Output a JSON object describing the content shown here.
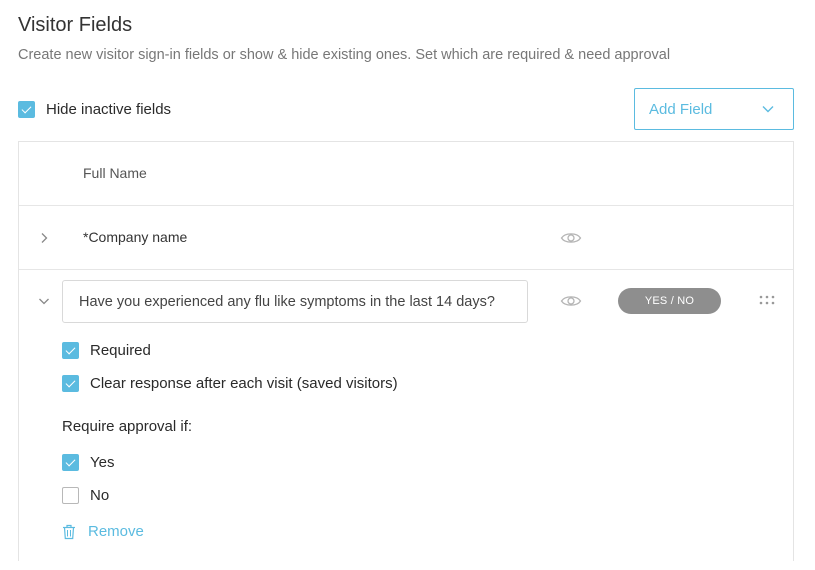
{
  "header": {
    "title": "Visitor Fields",
    "subtitle": "Create new visitor sign-in fields or show & hide existing ones. Set which are required & need approval"
  },
  "hide_inactive": {
    "label": "Hide inactive fields",
    "checked": true
  },
  "add_field": {
    "label": "Add Field"
  },
  "fields": [
    {
      "label": "Full Name"
    },
    {
      "label": "*Company name"
    }
  ],
  "expanded_field": {
    "question": "Have you experienced any flu like symptoms in the last 14 days?",
    "type_badge": "YES / NO",
    "options": [
      {
        "label": "Required",
        "checked": true
      },
      {
        "label": "Clear response after each visit (saved visitors)",
        "checked": true
      }
    ],
    "approval": {
      "title": "Require approval if:",
      "choices": [
        {
          "label": "Yes",
          "checked": true
        },
        {
          "label": "No",
          "checked": false
        }
      ]
    },
    "remove_label": "Remove"
  },
  "colors": {
    "accent": "#5bbbe0",
    "badge": "#8e8e8e",
    "border": "#e4e4e4"
  }
}
